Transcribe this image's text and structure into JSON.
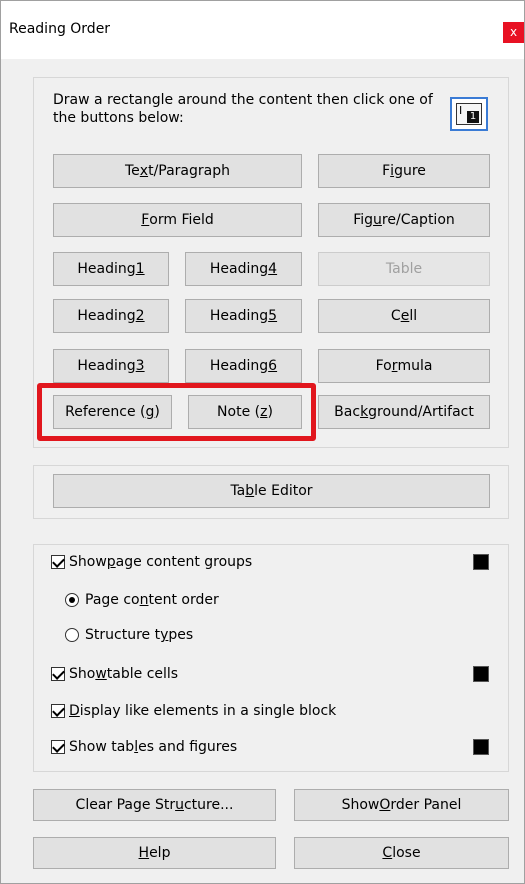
{
  "window": {
    "title": "Reading Order",
    "close_glyph": "x"
  },
  "instructions": "Draw a rectangle around the content then click one of the buttons below:",
  "icon": {
    "name": "reading-order-tool-icon",
    "glyph": "I",
    "number": "1"
  },
  "buttons": {
    "text_paragraph": [
      "Te",
      "x",
      "t/Paragraph"
    ],
    "figure": [
      "F",
      "i",
      "gure"
    ],
    "form_field": [
      "",
      "F",
      "orm Field"
    ],
    "figure_caption": [
      "Fig",
      "u",
      "re/Caption"
    ],
    "heading1": [
      "Heading ",
      "1",
      ""
    ],
    "heading4": [
      "Heading ",
      "4",
      ""
    ],
    "table": "Table",
    "heading2": [
      "Heading ",
      "2",
      ""
    ],
    "heading5": [
      "Heading ",
      "5",
      ""
    ],
    "cell": [
      "C",
      "e",
      "ll"
    ],
    "heading3": [
      "Heading ",
      "3",
      ""
    ],
    "heading6": [
      "Heading ",
      "6",
      ""
    ],
    "formula": [
      "Fo",
      "r",
      "mula"
    ],
    "reference": [
      "Reference (",
      "g",
      ")"
    ],
    "note": [
      "Note (",
      "z",
      ")"
    ],
    "background_artifact": [
      "Bac",
      "k",
      "ground/Artifact"
    ],
    "table_editor": [
      "Ta",
      "b",
      "le Editor"
    ],
    "clear_page_structure": [
      "Clear Page Str",
      "u",
      "cture..."
    ],
    "show_order_panel": [
      "Show ",
      "O",
      "rder Panel"
    ],
    "help": [
      "",
      "H",
      "elp"
    ],
    "close": [
      "",
      "C",
      "lose"
    ]
  },
  "options": {
    "show_page_content_groups": [
      "Show ",
      "p",
      "age content groups"
    ],
    "page_content_order": [
      "Page co",
      "n",
      "tent order"
    ],
    "structure_types": [
      "Structure t",
      "y",
      "pes"
    ],
    "show_table_cells": [
      "Sho",
      "w",
      " table cells"
    ],
    "display_like_elements": [
      "",
      "D",
      "isplay like elements in a single block"
    ],
    "show_tables_figures": [
      "Show tab",
      "l",
      "es and figures"
    ]
  },
  "colors": {
    "highlight": "#e1161d",
    "swatch": "#000000",
    "close_button": "#e81123"
  }
}
